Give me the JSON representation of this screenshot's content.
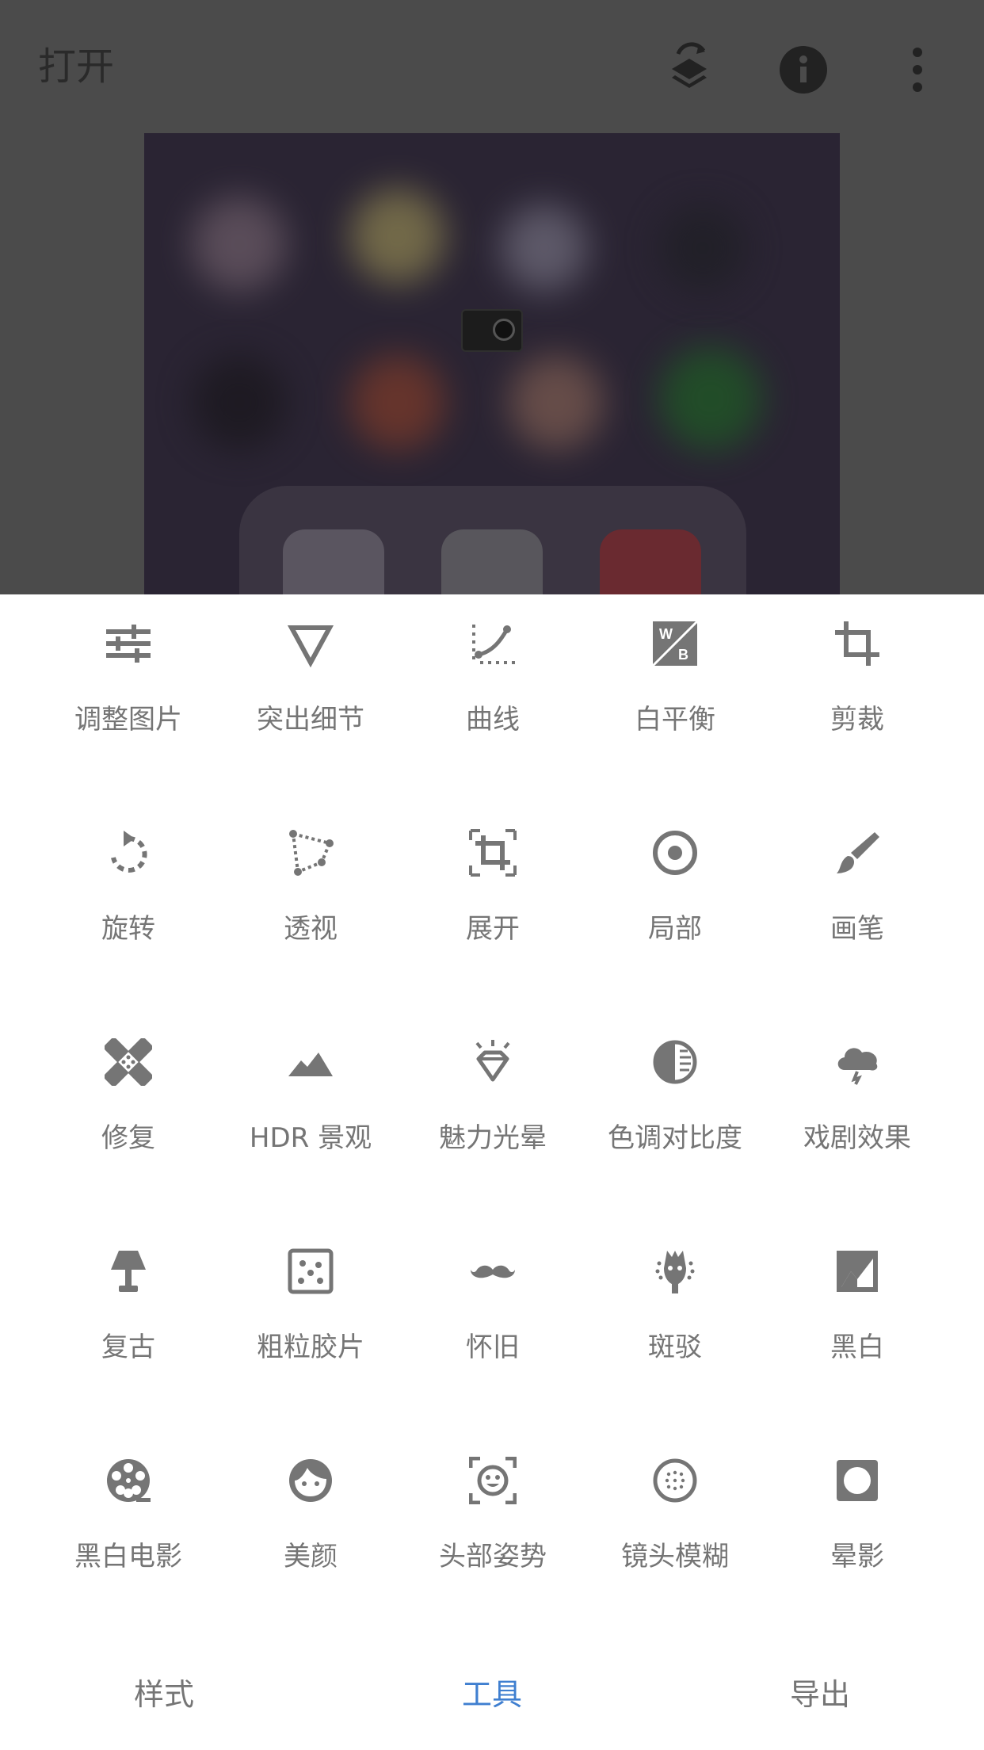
{
  "header": {
    "open_label": "打开",
    "icons": [
      "layers-undo-icon",
      "info-icon",
      "more-vert-icon"
    ]
  },
  "tools": [
    {
      "label": "调整图片",
      "icon": "tune-icon"
    },
    {
      "label": "突出细节",
      "icon": "triangle-details-icon"
    },
    {
      "label": "曲线",
      "icon": "curves-icon"
    },
    {
      "label": "白平衡",
      "icon": "white-balance-icon"
    },
    {
      "label": "剪裁",
      "icon": "crop-icon"
    },
    {
      "label": "旋转",
      "icon": "rotate-icon"
    },
    {
      "label": "透视",
      "icon": "perspective-icon"
    },
    {
      "label": "展开",
      "icon": "expand-icon"
    },
    {
      "label": "局部",
      "icon": "selective-icon"
    },
    {
      "label": "画笔",
      "icon": "brush-icon"
    },
    {
      "label": "修复",
      "icon": "healing-icon"
    },
    {
      "label": "HDR 景观",
      "icon": "hdr-landscape-icon"
    },
    {
      "label": "魅力光晕",
      "icon": "glamour-glow-icon"
    },
    {
      "label": "色调对比度",
      "icon": "tonal-contrast-icon"
    },
    {
      "label": "戏剧效果",
      "icon": "drama-icon"
    },
    {
      "label": "复古",
      "icon": "vintage-lamp-icon"
    },
    {
      "label": "粗粒胶片",
      "icon": "grainy-film-icon"
    },
    {
      "label": "怀旧",
      "icon": "mustache-icon"
    },
    {
      "label": "斑驳",
      "icon": "grunge-icon"
    },
    {
      "label": "黑白",
      "icon": "black-white-icon"
    },
    {
      "label": "黑白电影",
      "icon": "film-reel-icon"
    },
    {
      "label": "美颜",
      "icon": "face-icon"
    },
    {
      "label": "头部姿势",
      "icon": "head-pose-icon"
    },
    {
      "label": "镜头模糊",
      "icon": "lens-blur-icon"
    },
    {
      "label": "晕影",
      "icon": "vignette-icon"
    }
  ],
  "nav": {
    "styles": "样式",
    "tools": "工具",
    "export": "导出"
  },
  "colors": {
    "icon": "#757575",
    "active_tab": "#3f7fd0",
    "overlay": "#4b4b4b"
  }
}
